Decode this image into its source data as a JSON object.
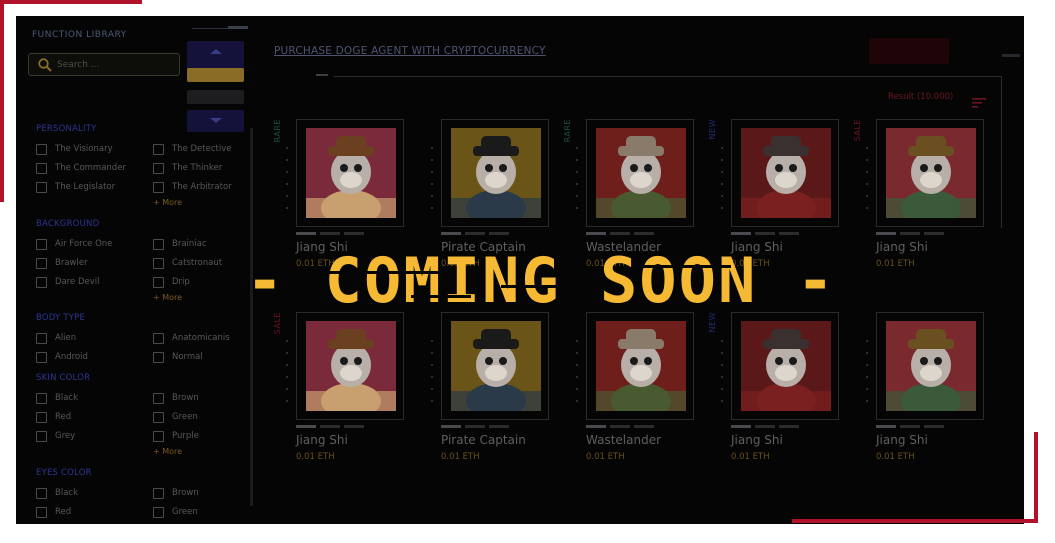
{
  "sidebar": {
    "title": "FUNCTION LIBRARY",
    "search_placeholder": "Search ...",
    "sections": [
      {
        "title": "PERSONALITY",
        "options": [
          "The Visionary",
          "The Detective",
          "The Commander",
          "The Thinker",
          "The Legislator",
          "The Arbitrator"
        ],
        "more": "+ More"
      },
      {
        "title": "BACKGROUND",
        "options": [
          "Air Force One",
          "Brainiac",
          "Brawler",
          "Catstronaut",
          "Dare Devil",
          "Drip"
        ],
        "more": "+ More"
      },
      {
        "title": "BODY TYPE",
        "options": [
          "Alien",
          "Anatomicanis",
          "Android",
          "Normal"
        ]
      },
      {
        "title": "SKIN COLOR",
        "options": [
          "Black",
          "Brown",
          "Red",
          "Green",
          "Grey",
          "Purple"
        ],
        "more": "+ More"
      },
      {
        "title": "EYES COLOR",
        "options": [
          "Black",
          "Brown",
          "Red",
          "Green"
        ]
      }
    ]
  },
  "main": {
    "title": "PURCHASE DOGE AGENT WITH CRYPTOCURRENCY",
    "result": "Result (10.000)",
    "cards": [
      {
        "name": "Jiang Shi",
        "price": "0.01 ETH",
        "tag": "RARE",
        "art": "cowboy"
      },
      {
        "name": "Pirate Captain",
        "price": "0.01 ETH",
        "tag": "",
        "art": "pirate"
      },
      {
        "name": "Wastelander",
        "price": "0.01 ETH",
        "tag": "RARE",
        "art": "waste"
      },
      {
        "name": "Jiang Shi",
        "price": "0.01 ETH",
        "tag": "NEW",
        "art": "brawler"
      },
      {
        "name": "Jiang Shi",
        "price": "0.01 ETH",
        "tag": "SALE",
        "art": "jiang"
      },
      {
        "name": "Jiang Shi",
        "price": "0.01 ETH",
        "tag": "SALE",
        "art": "cowboy"
      },
      {
        "name": "Pirate Captain",
        "price": "0.01 ETH",
        "tag": "",
        "art": "pirate"
      },
      {
        "name": "Wastelander",
        "price": "0.01 ETH",
        "tag": "",
        "art": "waste"
      },
      {
        "name": "Jiang Shi",
        "price": "0.01 ETH",
        "tag": "NEW",
        "art": "brawler"
      },
      {
        "name": "Jiang Shi",
        "price": "0.01 ETH",
        "tag": "",
        "art": "jiang"
      }
    ]
  },
  "overlay": {
    "text": "- COMING SOON -",
    "color": "#f5b934"
  },
  "colors": {
    "brand_red": "#b1122a",
    "background": "#050506",
    "accent_gold": "#f5b934"
  }
}
